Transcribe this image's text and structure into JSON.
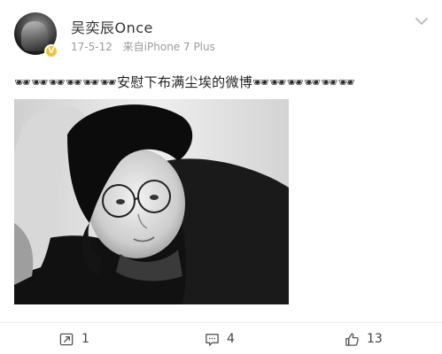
{
  "user": {
    "name": "吴奕辰Once",
    "badge": "V"
  },
  "meta": {
    "date": "17-5-12",
    "source": "来自iPhone 7 Plus"
  },
  "post": {
    "text": "🕶🕶🕶🕶🕶🕶安慰下布满尘埃的微博🕶🕶🕶🕶🕶🕶"
  },
  "actions": {
    "repost_count": "1",
    "comment_count": "4",
    "like_count": "13"
  },
  "icons": {
    "avatar": "avatar-image",
    "verified": "verified-badge-icon",
    "more": "chevron-down-icon",
    "repost": "repost-icon",
    "comment": "comment-icon",
    "like": "thumbs-up-icon"
  },
  "colors": {
    "badge": "#f6c233",
    "meta_text": "#9b9b9b",
    "icon": "#555555"
  }
}
